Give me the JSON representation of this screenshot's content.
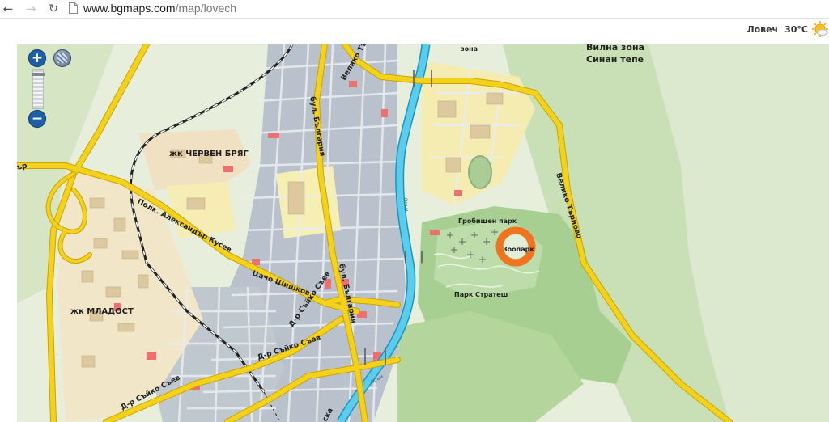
{
  "browser": {
    "back_icon": "arrow-left",
    "forward_icon": "arrow-right",
    "reload_icon": "reload",
    "url_host": "www.bgmaps.com",
    "url_path": "/map/lovech"
  },
  "weather": {
    "city": "Ловеч",
    "temperature": "30°C",
    "icon": "sun-cloud"
  },
  "controls": {
    "zoom_in": "+",
    "zoom_out": "−",
    "layer_icon": "map-layers"
  },
  "colors": {
    "road_major": "#f4d21c",
    "road_edge": "#c9a400",
    "river": "#36bde0",
    "park": "#a4cd8e",
    "marker": "#f0731f"
  },
  "labels": {
    "zh_cherven_bryag": "жк ЧЕРВЕН БРЯГ",
    "zh_mladost": "жк МЛАДОСТ",
    "vila_zona": "Вилна зона",
    "sinan_tepe": "Синан тепе",
    "grobishten_park": "Гробищен парк",
    "zoopark": "Зоопарк",
    "park_stratesh": "Парк Стратеш",
    "veliko_tarnovo_top": "Велико Търново",
    "veliko_tarnovo_right": "Велико Търново",
    "bul_bulgaria_top": "бул. България",
    "bul_bulgaria_bottom": "бул. България",
    "polk_kusev": "Полк. Александър Кусев",
    "tsacho_shishkov": "Цачо Шишков",
    "dr_syyko_syev_a": "Д-р Съйко Съев",
    "dr_syyko_syev_b": "Д-р Съйко Съев",
    "dr_syyko_syev_c": "Д-р Съйко Съев",
    "zona_top": "зона",
    "edge_left": "ър",
    "river_osam_a": "Осъм",
    "river_osam_b": "Осъм",
    "bottom_street": "ска"
  }
}
